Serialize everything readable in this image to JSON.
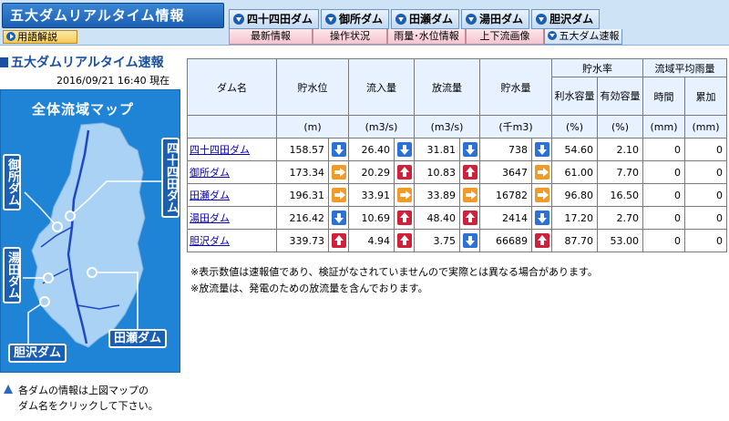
{
  "header": {
    "title": "五大ダムリアルタイム情報",
    "glossary_label": "用語解説",
    "dam_tabs": [
      "四十四田ダム",
      "御所ダム",
      "田瀬ダム",
      "湯田ダム",
      "胆沢ダム"
    ],
    "sub_tabs": [
      "最新情報",
      "操作状況",
      "雨量･水位情報",
      "上下流画像",
      "五大ダム速報"
    ]
  },
  "left": {
    "title": "五大ダムリアルタイム速報",
    "timestamp": "2016/09/21 16:40 現在",
    "map_heading": "全体流域マップ",
    "map_labels": [
      "四十四田ダム",
      "御所ダム",
      "湯田ダム",
      "田瀬ダム",
      "胆沢ダム"
    ],
    "note_line1": "各ダムの情報は上図マップの",
    "note_line2": "ダム名をクリックして下さい。",
    "colors": {
      "map_bg": "#1f84d6",
      "land": "#a9d2f5",
      "label_bg": "#1a5fb4"
    }
  },
  "table": {
    "headers": {
      "dam_name": "ダム名",
      "water_level": "貯水位",
      "inflow": "流入量",
      "outflow": "放流量",
      "storage": "貯水量",
      "storage_rate": "貯水率",
      "usable_capacity": "利水容量",
      "effective_capacity": "有効容量",
      "rainfall": "流域平均雨量",
      "hourly": "時間",
      "cumulative": "累加"
    },
    "units": [
      "(m)",
      "(m3/s)",
      "(m3/s)",
      "(千m3)",
      "(%)",
      "(%)",
      "(mm)",
      "(mm)"
    ],
    "rows": [
      {
        "name": "四十四田ダム",
        "level": "158.57",
        "level_trend": "down",
        "inflow": "26.40",
        "inflow_trend": "down",
        "outflow": "31.81",
        "outflow_trend": "down",
        "storage": "738",
        "storage_trend": "down",
        "usable": "54.60",
        "effective": "2.10",
        "hourly": "0",
        "cumulative": "0"
      },
      {
        "name": "御所ダム",
        "level": "173.34",
        "level_trend": "flat",
        "inflow": "20.29",
        "inflow_trend": "up",
        "outflow": "10.83",
        "outflow_trend": "up",
        "storage": "3647",
        "storage_trend": "flat",
        "usable": "61.00",
        "effective": "7.70",
        "hourly": "0",
        "cumulative": "0"
      },
      {
        "name": "田瀬ダム",
        "level": "196.31",
        "level_trend": "flat",
        "inflow": "33.91",
        "inflow_trend": "flat",
        "outflow": "33.89",
        "outflow_trend": "flat",
        "storage": "16782",
        "storage_trend": "flat",
        "usable": "96.80",
        "effective": "16.50",
        "hourly": "0",
        "cumulative": "0"
      },
      {
        "name": "湯田ダム",
        "level": "216.42",
        "level_trend": "down",
        "inflow": "10.69",
        "inflow_trend": "up",
        "outflow": "48.40",
        "outflow_trend": "up",
        "storage": "2414",
        "storage_trend": "down",
        "usable": "17.20",
        "effective": "2.70",
        "hourly": "0",
        "cumulative": "0"
      },
      {
        "name": "胆沢ダム",
        "level": "339.73",
        "level_trend": "up",
        "inflow": "4.94",
        "inflow_trend": "up",
        "outflow": "3.75",
        "outflow_trend": "down",
        "storage": "66689",
        "storage_trend": "up",
        "usable": "87.70",
        "effective": "53.00",
        "hourly": "0",
        "cumulative": "0"
      }
    ]
  },
  "footnotes": [
    "※表示数値は速報値であり、検証がなされていませんので実際とは異なる場合があります。",
    "※放流量は、発電のための放流量を含んでおります。"
  ]
}
